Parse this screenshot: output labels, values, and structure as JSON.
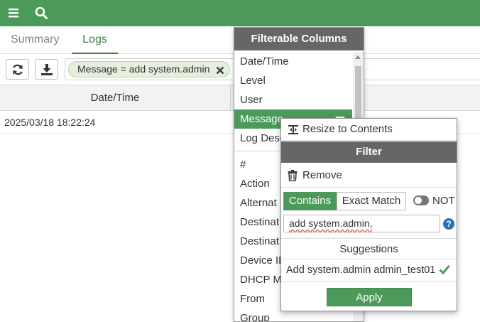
{
  "topbar": {
    "menu_icon": "hamburger-icon",
    "search_icon": "search-icon",
    "color": "#4c9a5a"
  },
  "tabs": [
    {
      "label": "Summary",
      "active": false
    },
    {
      "label": "Logs",
      "active": true
    }
  ],
  "toolbar": {
    "refresh_icon": "refresh-icon",
    "download_icon": "download-icon",
    "filter_chip": "Message = add system.admin"
  },
  "table": {
    "columns": [
      "Date/Time"
    ],
    "rows": [
      {
        "datetime": "2025/03/18 18:22:24"
      }
    ]
  },
  "filterable_columns": {
    "title": "Filterable Columns",
    "top_items": [
      "Date/Time",
      "Level",
      "User",
      "Message",
      "Log Desc"
    ],
    "selected": "Message",
    "other_items": [
      "#",
      "Action",
      "Alternat",
      "Destinat",
      "Destinat",
      "Device ID",
      "DHCP M",
      "From",
      "Group"
    ]
  },
  "filter_popup": {
    "resize_label": "Resize to Contents",
    "title": "Filter",
    "remove_label": "Remove",
    "mode_contains": "Contains",
    "mode_exact": "Exact Match",
    "not_label": "NOT",
    "not_enabled": false,
    "input_value": "add system.admin,",
    "help_glyph": "?",
    "suggestions_title": "Suggestions",
    "suggestions": [
      "Add system.admin admin_test01"
    ],
    "apply_label": "Apply"
  }
}
